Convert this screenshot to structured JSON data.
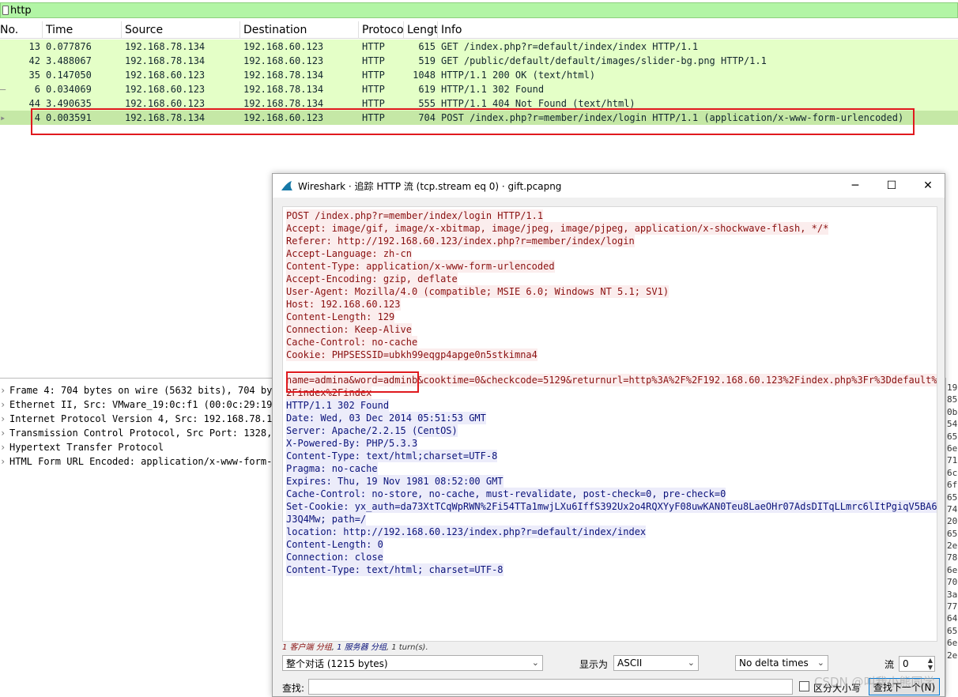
{
  "filter": {
    "value": "http"
  },
  "columns": [
    "No.",
    "Time",
    "Source",
    "Destination",
    "Protoco",
    "Lengt",
    "Info"
  ],
  "packets": [
    {
      "mark": "",
      "no": "13",
      "time": "0.077876",
      "src": "192.168.78.134",
      "dst": "192.168.60.123",
      "proto": "HTTP",
      "len": "615",
      "info": "GET /index.php?r=default/index/index HTTP/1.1"
    },
    {
      "mark": "",
      "no": "42",
      "time": "3.488067",
      "src": "192.168.78.134",
      "dst": "192.168.60.123",
      "proto": "HTTP",
      "len": "519",
      "info": "GET /public/default/default/images/slider-bg.png HTTP/1.1"
    },
    {
      "mark": "",
      "no": "35",
      "time": "0.147050",
      "src": "192.168.60.123",
      "dst": "192.168.78.134",
      "proto": "HTTP",
      "len": "1048",
      "info": "HTTP/1.1 200 OK  (text/html)"
    },
    {
      "mark": "–",
      "no": "6",
      "time": "0.034069",
      "src": "192.168.60.123",
      "dst": "192.168.78.134",
      "proto": "HTTP",
      "len": "619",
      "info": "HTTP/1.1 302 Found"
    },
    {
      "mark": "",
      "no": "44",
      "time": "3.490635",
      "src": "192.168.60.123",
      "dst": "192.168.78.134",
      "proto": "HTTP",
      "len": "555",
      "info": "HTTP/1.1 404 Not Found  (text/html)"
    },
    {
      "mark": "▸",
      "no": "4",
      "time": "0.003591",
      "src": "192.168.78.134",
      "dst": "192.168.60.123",
      "proto": "HTTP",
      "len": "704",
      "info": "POST /index.php?r=member/index/login HTTP/1.1  (application/x-www-form-urlencoded)"
    }
  ],
  "details": [
    "Frame 4: 704 bytes on wire (5632 bits), 704 byt",
    "Ethernet II, Src: VMware_19:0c:f1 (00:0c:29:19:",
    "Internet Protocol Version 4, Src: 192.168.78.13",
    "Transmission Control Protocol, Src Port: 1328,",
    "Hypertext Transfer Protocol",
    "HTML Form URL Encoded: application/x-www-form-u"
  ],
  "hex_right": [
    "19",
    "85",
    "0b",
    "54",
    "65",
    "6e",
    "71",
    "6c",
    "6f",
    "65",
    "74",
    "20",
    "65",
    "2e",
    "78",
    "6e",
    "70",
    "3a",
    "77",
    "64",
    "65",
    "6e",
    "2e"
  ],
  "dialog": {
    "title": "Wireshark · 追踪 HTTP 流 (tcp.stream eq 0) · gift.pcapng",
    "minimize": "─",
    "maximize": "☐",
    "close": "✕",
    "client_lines": [
      "POST /index.php?r=member/index/login HTTP/1.1",
      "Accept: image/gif, image/x-xbitmap, image/jpeg, image/pjpeg, application/x-shockwave-flash, */*",
      "Referer: http://192.168.60.123/index.php?r=member/index/login",
      "Accept-Language: zh-cn",
      "Content-Type: application/x-www-form-urlencoded",
      "Accept-Encoding: gzip, deflate",
      "User-Agent: Mozilla/4.0 (compatible; MSIE 6.0; Windows NT 5.1; SV1)",
      "Host: 192.168.60.123",
      "Content-Length: 129",
      "Connection: Keep-Alive",
      "Cache-Control: no-cache",
      "Cookie: PHPSESSID=ubkh99eqgp4apge0n5stkimna4"
    ],
    "body_line1": "name=admina&word=adminb&cooktime=0&checkcode=5129&returnurl=http%3A%2F%2F192.168.60.123%2Findex.php%3Fr%3Ddefault%",
    "body_line2": "2Findex%2Findex",
    "server_lines": [
      "HTTP/1.1 302 Found",
      "Date: Wed, 03 Dec 2014 05:51:53 GMT",
      "Server: Apache/2.2.15 (CentOS)",
      "X-Powered-By: PHP/5.3.3",
      "Content-Type: text/html;charset=UTF-8",
      "Pragma: no-cache",
      "Expires: Thu, 19 Nov 1981 08:52:00 GMT",
      "Cache-Control: no-store, no-cache, must-revalidate, post-check=0, pre-check=0",
      "Set-Cookie: yx_auth=da73XtTCqWpRWN%2Fi54TTa1mwjLXu6IffS392Ux2o4RQXYyF08uwKAN0Teu8LaeOHr07AdsDITqLLmrc6lItPgiqV5BA6",
      "J3Q4Mw; path=/",
      "location: http://192.168.60.123/index.php?r=default/index/index",
      "Content-Length: 0",
      "Connection: close",
      "Content-Type: text/html; charset=UTF-8"
    ],
    "status": {
      "client": "1 客户端 分组",
      "server": "1 服务器 分组",
      "turns": "1 turn(s)."
    },
    "conversation_select": "整个对话 (1215 bytes)",
    "show_as_label": "显示为",
    "show_as_value": "ASCII",
    "delta_select": "No delta times",
    "stream_label": "流",
    "stream_value": "0",
    "find_label": "查找:",
    "case_label": "区分大小写",
    "find_next": "查找下一个(N)"
  },
  "watermark": "CSDN @叫我小熊同学"
}
